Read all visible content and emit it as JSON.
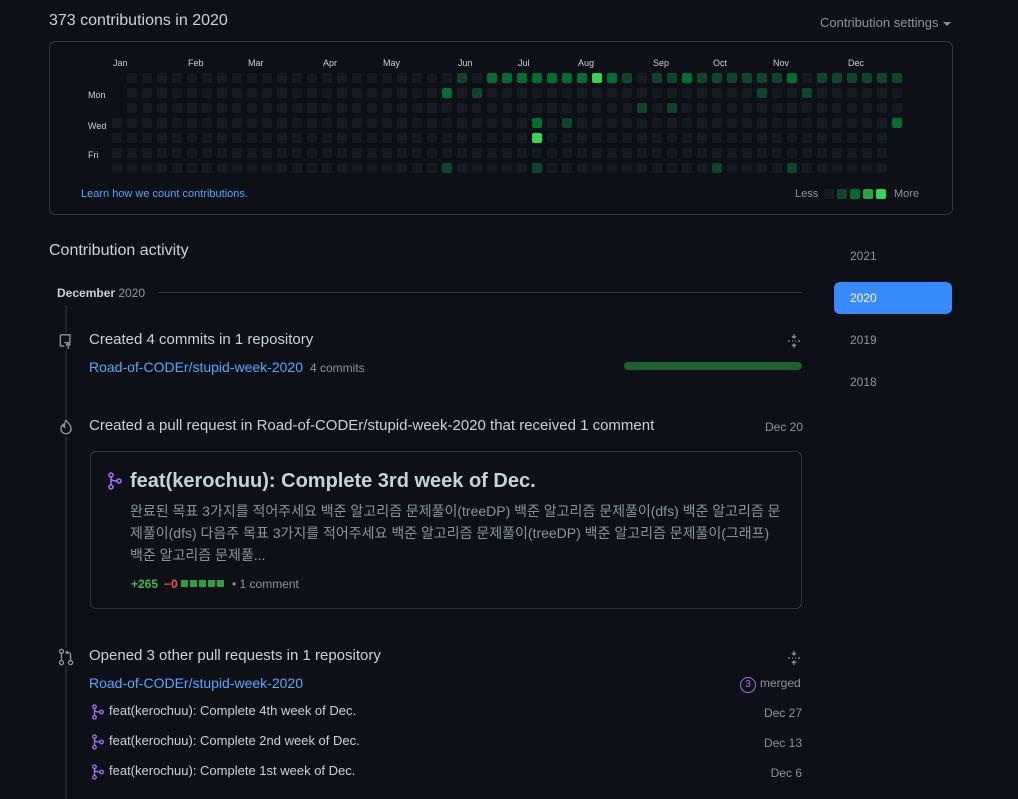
{
  "header": {
    "contributions_title": "373 contributions in 2020",
    "settings_label": "Contribution settings"
  },
  "calendar": {
    "months": [
      "Jan",
      "Feb",
      "Mar",
      "Apr",
      "May",
      "Jun",
      "Jul",
      "Aug",
      "Sep",
      "Oct",
      "Nov",
      "Dec"
    ],
    "days": [
      "Mon",
      "Wed",
      "Fri"
    ],
    "learn_link": "Learn how we count contributions.",
    "legend_less": "Less",
    "legend_more": "More",
    "level_colors": [
      "#161b22",
      "#0e4429",
      "#006d32",
      "#26a641",
      "#39d353"
    ]
  },
  "activity": {
    "title": "Contribution activity",
    "month_label": "December",
    "year_label": "2020"
  },
  "years": [
    "2021",
    "2020",
    "2019",
    "2018"
  ],
  "events": {
    "commits": {
      "title": "Created 4 commits in 1 repository",
      "repo": "Road-of-CODEr/stupid-week-2020",
      "count": "4 commits",
      "bar_fraction": 1.0
    },
    "pull_request": {
      "title": "Created a pull request in Road-of-CODEr/stupid-week-2020 that received 1 comment",
      "date": "Dec 20",
      "pr_title": "feat(kerochuu): Complete 3rd week of Dec.",
      "body": "완료된 목표 3가지를 적어주세요 백준 알고리즘 문제풀이(treeDP) 백준 알고리즘 문제풀이(dfs) 백준 알고리즘 문제풀이(dfs) 다음주 목표 3가지를 적어주세요 백준 알고리즘 문제풀이(treeDP) 백준 알고리즘 문제풀이(그래프) 백준 알고리즘 문제풀...",
      "additions": "+265",
      "deletions": "−0",
      "comments": "• 1 comment"
    },
    "other_prs": {
      "title": "Opened 3 other pull requests in 1 repository",
      "repo": "Road-of-CODEr/stupid-week-2020",
      "merged_count": "3",
      "merged_label": "merged",
      "items": [
        {
          "title": "feat(kerochuu): Complete 4th week of Dec.",
          "date": "Dec 27"
        },
        {
          "title": "feat(kerochuu): Complete 2nd week of Dec.",
          "date": "Dec 13"
        },
        {
          "title": "feat(kerochuu): Complete 1st week of Dec.",
          "date": "Dec 6"
        }
      ]
    }
  }
}
